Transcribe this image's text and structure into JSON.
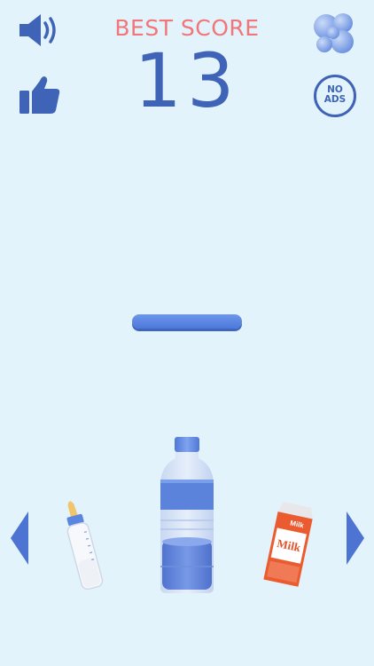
{
  "header": {
    "best_label": "BEST SCORE",
    "best_value": "13"
  },
  "buttons": {
    "no_ads_line1": "NO",
    "no_ads_line2": "ADS"
  },
  "carousel": {
    "left_item": "baby-bottle",
    "center_item": "water-bottle",
    "right_item": "milk-carton",
    "milk_label": "Milk"
  },
  "colors": {
    "background": "#e3f3fb",
    "accent_blue": "#3f63b6",
    "best_score_red": "#f0767a",
    "platform": "#5a84e0"
  },
  "icons": [
    "speaker-icon",
    "thumbs-up-icon",
    "bubbles-icon",
    "no-ads-icon",
    "arrow-left-icon",
    "arrow-right-icon"
  ]
}
